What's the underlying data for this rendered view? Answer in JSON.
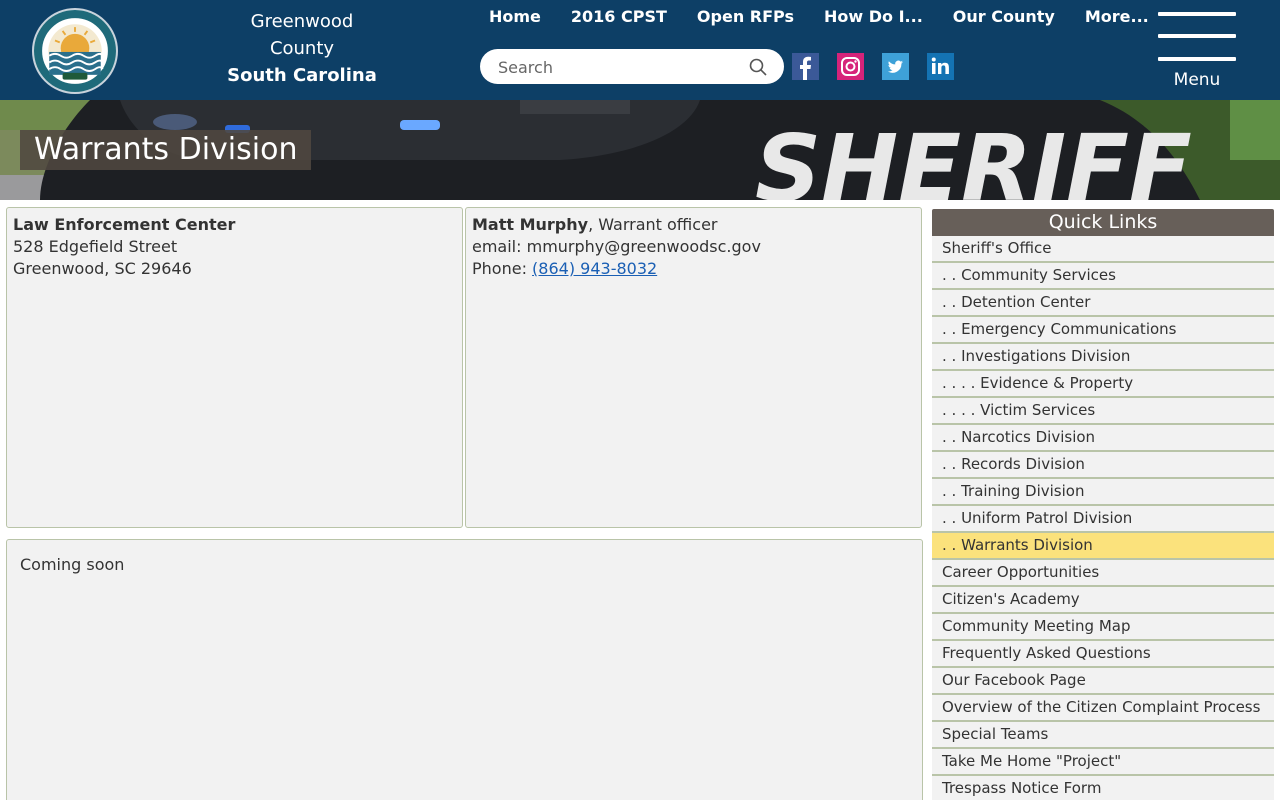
{
  "header": {
    "county_line1": "Greenwood",
    "county_line2": "County",
    "state": "South Carolina",
    "nav": [
      "Home",
      "2016 CPST",
      "Open RFPs",
      "How Do I...",
      "Our County",
      "More..."
    ],
    "search_placeholder": "Search",
    "menu_label": "Menu",
    "social": [
      "facebook-icon",
      "instagram-icon",
      "twitter-icon",
      "linkedin-icon"
    ],
    "colors": {
      "header_bg": "#0d3f66",
      "facebook": "#3b5998",
      "instagram": "#d6237a",
      "twitter": "#3ea1d8",
      "linkedin": "#1473b3"
    }
  },
  "banner": {
    "title": "Warrants Division",
    "vehicle_text": "SHERIFF"
  },
  "location": {
    "name": "Law Enforcement Center",
    "street": "528 Edgefield Street",
    "city": "Greenwood, SC 29646"
  },
  "contact": {
    "name": "Matt Murphy",
    "role": ", Warrant officer",
    "email_label": "email: ",
    "email": "mmurphy@greenwoodsc.gov",
    "phone_label": "Phone: ",
    "phone": "(864) 943-8032"
  },
  "main": {
    "text": "Coming soon"
  },
  "quick_links": {
    "title": "Quick Links",
    "active_index": 11,
    "items": [
      "Sheriff's Office",
      ". . Community Services",
      ". . Detention Center",
      ". . Emergency Communications",
      ". . Investigations Division",
      ". . . . Evidence & Property",
      ". . . . Victim Services",
      ". . Narcotics Division",
      ". . Records Division",
      ". . Training Division",
      ". . Uniform Patrol Division",
      ". . Warrants Division",
      "Career Opportunities",
      "Citizen's Academy",
      "Community Meeting Map",
      "Frequently Asked Questions",
      "Our Facebook Page",
      "Overview of the Citizen Complaint Process",
      "Special Teams",
      "Take Me Home \"Project\"",
      "Trespass Notice Form"
    ]
  }
}
